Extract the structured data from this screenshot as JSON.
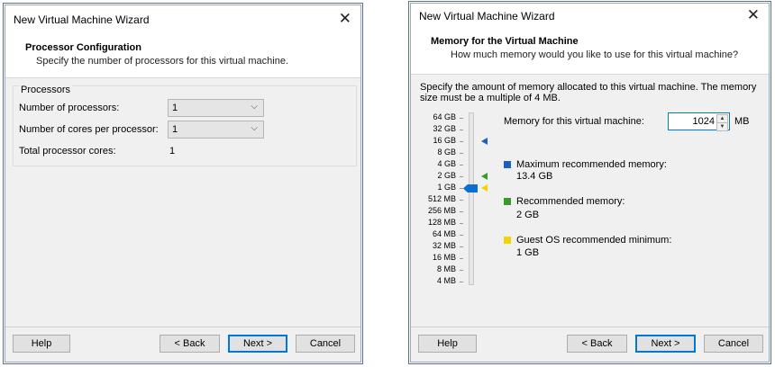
{
  "left_dialog": {
    "title": "New Virtual Machine Wizard",
    "header_title": "Processor Configuration",
    "header_sub": "Specify the number of processors for this virtual machine.",
    "group_label": "Processors",
    "num_processors_label": "Number of processors:",
    "num_processors_value": "1",
    "cores_label": "Number of cores per processor:",
    "cores_value": "1",
    "total_label": "Total processor cores:",
    "total_value": "1",
    "buttons": {
      "help": "Help",
      "back": "< Back",
      "next": "Next >",
      "cancel": "Cancel"
    }
  },
  "right_dialog": {
    "title": "New Virtual Machine Wizard",
    "header_title": "Memory for the Virtual Machine",
    "header_sub": "How much memory would you like to use for this virtual machine?",
    "instructions": "Specify the amount of memory allocated to this virtual machine. The memory size must be a multiple of 4 MB.",
    "scale": [
      "64 GB",
      "32 GB",
      "16 GB",
      "8 GB",
      "4 GB",
      "2 GB",
      "1 GB",
      "512 MB",
      "256 MB",
      "128 MB",
      "64 MB",
      "32 MB",
      "16 MB",
      "8 MB",
      "4 MB"
    ],
    "memory_label": "Memory for this virtual machine:",
    "memory_value": "1024",
    "memory_unit": "MB",
    "max_label": "Maximum recommended memory:",
    "max_value": "13.4 GB",
    "rec_label": "Recommended memory:",
    "rec_value": "2 GB",
    "min_label": "Guest OS recommended minimum:",
    "min_value": "1 GB",
    "colors": {
      "max": "#1f5fbf",
      "recommended": "#3a9a2a",
      "minimum": "#f2d500",
      "slider": "#0a6fd1"
    },
    "buttons": {
      "help": "Help",
      "back": "< Back",
      "next": "Next >",
      "cancel": "Cancel"
    }
  }
}
